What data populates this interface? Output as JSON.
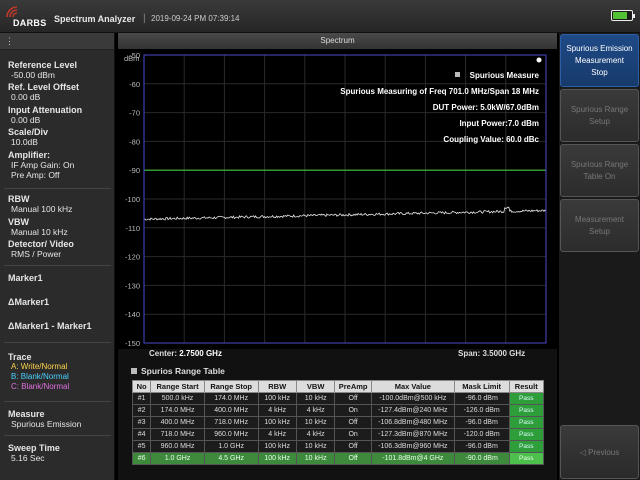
{
  "header": {
    "brand": "DARBS",
    "app_title": "Spectrum Analyzer",
    "separator": "|",
    "datetime": "2019-09-24 PM 07:39:14"
  },
  "left_panel": {
    "drag_handle": "⋮",
    "reference_level": {
      "label": "Reference Level",
      "value": "-50.00 dBm"
    },
    "ref_level_offset": {
      "label": "Ref. Level Offset",
      "value": "0.00 dB"
    },
    "input_attenuation": {
      "label": "Input Attenuation",
      "value": "0.00 dB"
    },
    "scale_div": {
      "label": "Scale/Div",
      "value": "10.0dB"
    },
    "amplifier": {
      "label": "Amplifier:",
      "if_amp_gain": "IF Amp Gain: On",
      "pre_amp": "Pre Amp: Off"
    },
    "rbw": {
      "label": "RBW",
      "value": "Manual 100 kHz"
    },
    "vbw": {
      "label": "VBW",
      "value": "Manual 10 kHz"
    },
    "detector": {
      "label": "Detector/ Video",
      "value": "RMS / Power"
    },
    "marker1": "Marker1",
    "delta_marker1": "ΔMarker1",
    "delta_marker1_minus": "ΔMarker1 - Marker1",
    "trace": {
      "label": "Trace",
      "a": "A: Write/Normal",
      "b": "B: Blank/Normal",
      "c": "C: Blank/Normal",
      "colors": {
        "a": "#ffd54a",
        "b": "#4ad0ff",
        "c": "#e070e0"
      }
    },
    "measure": {
      "label": "Measure",
      "value": "Spurious Emission"
    },
    "sweep_time": {
      "label": "Sweep Time",
      "value": "5.16 Sec"
    }
  },
  "spectrum": {
    "title": "Spectrum",
    "unit": "dBm",
    "y_ticks": [
      "-50",
      "-60",
      "-70",
      "-80",
      "-90",
      "-100",
      "-110",
      "-120",
      "-130",
      "-140",
      "-150"
    ],
    "info": {
      "title": "Spurious Measure",
      "line1": "Spurious Measuring of Freq 701.0 MHz/Span 18 MHz",
      "line2": "DUT Power: 5.0kW/67.0dBm",
      "line3": "Input Power:7.0 dBm",
      "line4": "Coupling Value: 60.0 dBc"
    },
    "center_label": "Center:",
    "center_value": "2.7500 GHz",
    "span_label": "Span:",
    "span_value": "3.5000 GHz",
    "limit_line_dbm": -90,
    "ylim": [
      -150,
      -50
    ],
    "trace_start_dbm": -107,
    "trace_end_dbm": -104,
    "colors": {
      "grid": "#2a2a2a",
      "trace": "#e8e8e8",
      "limit": "#3ec43e",
      "frame": "#4a4acf"
    }
  },
  "range_table": {
    "title": "Spurios Range Table",
    "headers": [
      "No",
      "Range Start",
      "Range Stop",
      "RBW",
      "VBW",
      "PreAmp",
      "Max Value",
      "Mask Limit",
      "Result"
    ],
    "rows": [
      [
        "#1",
        "500.0 kHz",
        "174.0 MHz",
        "100 kHz",
        "10 kHz",
        "Off",
        "-100.0dBm@500 kHz",
        "-96.0 dBm",
        "Pass"
      ],
      [
        "#2",
        "174.0 MHz",
        "400.0 MHz",
        "4 kHz",
        "4 kHz",
        "On",
        "-127.4dBm@240 MHz",
        "-126.0 dBm",
        "Pass"
      ],
      [
        "#3",
        "400.0 MHz",
        "718.0 MHz",
        "100 kHz",
        "10 kHz",
        "Off",
        "-106.8dBm@480 MHz",
        "-96.0 dBm",
        "Pass"
      ],
      [
        "#4",
        "718.0 MHz",
        "960.0 MHz",
        "4 kHz",
        "4 kHz",
        "On",
        "-127.3dBm@870 MHz",
        "-120.0 dBm",
        "Pass"
      ],
      [
        "#5",
        "960.0 MHz",
        "1.0 GHz",
        "100 kHz",
        "10 kHz",
        "Off",
        "-106.3dBm@960 MHz",
        "-96.0 dBm",
        "Pass"
      ],
      [
        "#6",
        "1.0 GHz",
        "4.5 GHz",
        "100 kHz",
        "10 kHz",
        "Off",
        "-101.8dBm@4 GHz",
        "-90.0 dBm",
        "Pass"
      ]
    ],
    "selected_row": 5
  },
  "softkeys": {
    "spurious_stop": [
      "Spurious Emission",
      "Measurement",
      "Stop"
    ],
    "range_setup": [
      "Spurious Range",
      "Setup"
    ],
    "range_table_on": [
      "Spurious Range",
      "Table On"
    ],
    "measurement_setup": [
      "Measurement",
      "Setup"
    ],
    "previous": "◁ Previous"
  }
}
